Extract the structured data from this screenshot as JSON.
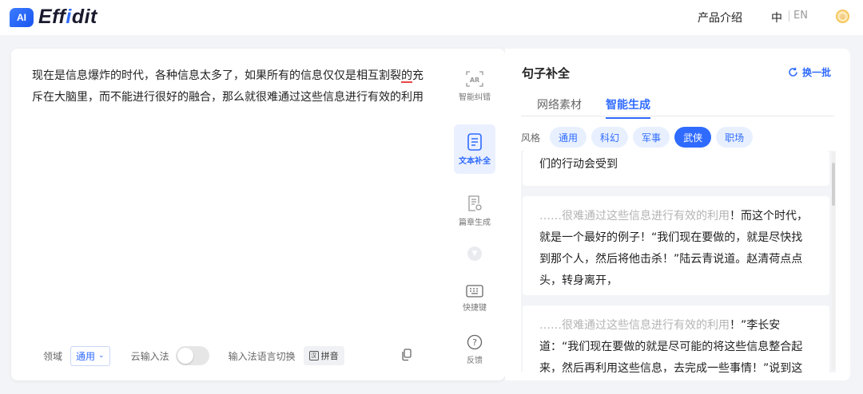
{
  "header": {
    "logo_badge": "AI",
    "logo_text_pre": "Eff",
    "logo_text_accent": "i",
    "logo_text_post": "dit",
    "product_intro": "产品介绍",
    "lang_zh": "中",
    "lang_en": "EN",
    "coin_icon": "coin-icon"
  },
  "editor": {
    "text_before_error": "现在是信息爆炸的时代，各种信息太多了，如果所有的信息仅仅是相互割裂",
    "text_error": "的",
    "text_after_error": "充斥在大脑里，而不能进行很好的融合，那么就很难通过这些信息进行有效的利用",
    "footer": {
      "domain_label": "领域",
      "domain_value": "通用",
      "cloud_ime_label": "云输入法",
      "cloud_ime_enabled": false,
      "ime_switch_label": "输入法语言切换",
      "ime_button_icon_text": "汉",
      "ime_button_label": "拼音"
    }
  },
  "tools": [
    {
      "label": "智能纠错",
      "icon": "smart-correct-icon",
      "active": false
    },
    {
      "label": "文本补全",
      "icon": "text-complete-icon",
      "active": true
    },
    {
      "label": "篇章生成",
      "icon": "article-generate-icon",
      "active": false
    },
    {
      "label": "快捷键",
      "icon": "keyboard-icon",
      "active": false
    },
    {
      "label": "反馈",
      "icon": "help-icon",
      "active": false
    }
  ],
  "panel": {
    "title": "句子补全",
    "refresh_label": "换一批",
    "tabs": [
      {
        "label": "网络素材",
        "active": false
      },
      {
        "label": "智能生成",
        "active": true
      }
    ],
    "style_label": "风格",
    "styles": [
      {
        "label": "通用",
        "active": false
      },
      {
        "label": "科幻",
        "active": false
      },
      {
        "label": "军事",
        "active": false
      },
      {
        "label": "武侠",
        "active": true
      },
      {
        "label": "职场",
        "active": false
      }
    ],
    "results": [
      {
        "context": "",
        "text": "们的行动会受到"
      },
      {
        "context": "……很难通过这些信息进行有效的利用",
        "text": "！而这个时代，就是一个最好的例子！“我们现在要做的，就是尽快找到那个人，然后将他击杀！”陆云青说道。赵清荷点点头，转身离开，"
      },
      {
        "context": "……很难通过这些信息进行有效的利用",
        "text": "！”李长安道：“我们现在要做的就是尽可能的将这些信息整合起来，然后再利用这些信息，去完成一些事情！”说到这里，"
      }
    ]
  }
}
